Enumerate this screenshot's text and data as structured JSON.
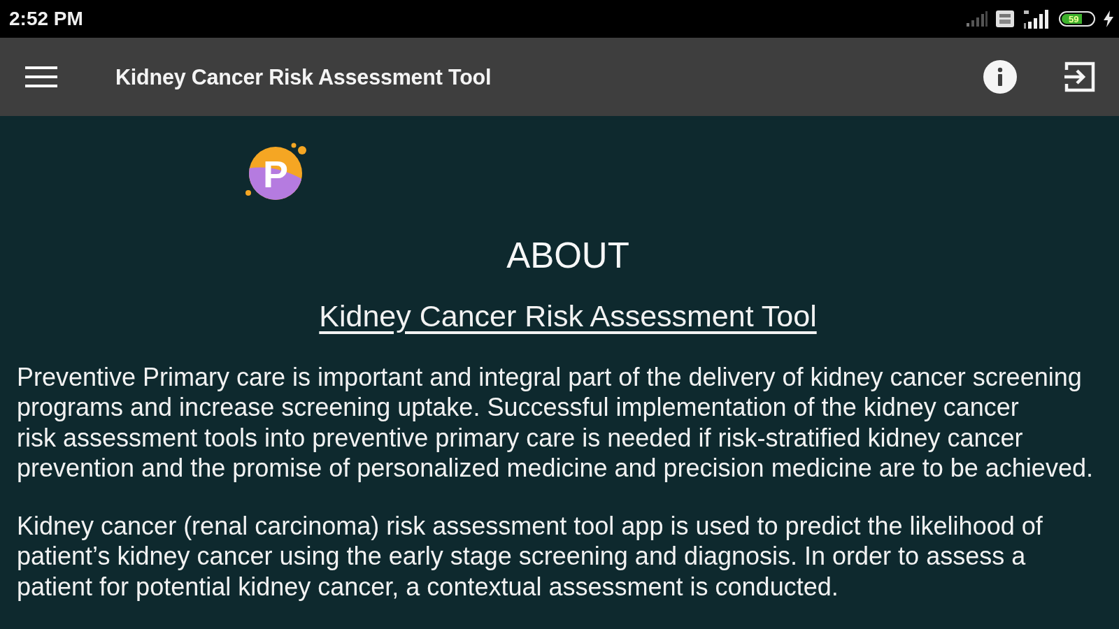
{
  "status_bar": {
    "time": "2:52 PM",
    "battery": "59"
  },
  "toolbar": {
    "title": "Kidney Cancer Risk Assessment Tool"
  },
  "logo": {
    "letter": "P"
  },
  "about": {
    "heading": "ABOUT",
    "link": "Kidney Cancer Risk Assessment Tool",
    "paragraphs": [
      "Preventive Primary care is important and integral part of the delivery of kidney cancer screening\nprograms and increase screening uptake. Successful implementation of the kidney cancer\nrisk assessment tools into preventive primary care is needed if risk-stratified kidney cancer\nprevention and the promise of personalized medicine and precision medicine are to be achieved.",
      "Kidney cancer (renal carcinoma) risk assessment tool app is used to predict the likelihood of\npatient’s kidney cancer using the early stage screening and diagnosis. In order to assess a\npatient for potential kidney cancer, a contextual assessment is conducted."
    ]
  }
}
